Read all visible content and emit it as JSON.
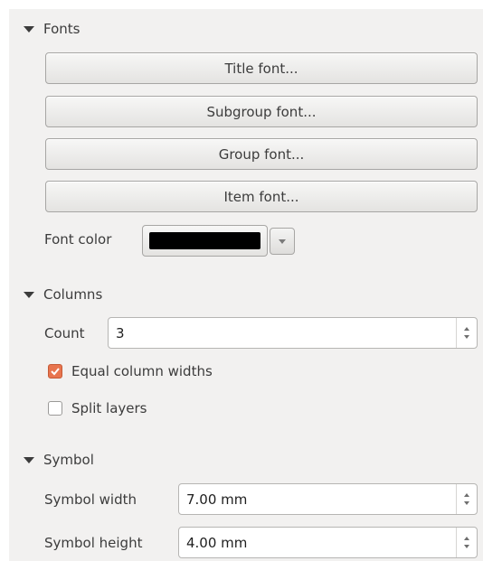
{
  "fonts": {
    "header": "Fonts",
    "buttons": [
      "Title font...",
      "Subgroup font...",
      "Group font...",
      "Item font..."
    ],
    "color_label": "Font color",
    "color_value": "#000000"
  },
  "columns": {
    "header": "Columns",
    "count_label": "Count",
    "count_value": "3",
    "equal_widths_label": "Equal column widths",
    "equal_widths_checked": true,
    "split_layers_label": "Split layers",
    "split_layers_checked": false
  },
  "symbol": {
    "header": "Symbol",
    "width_label": "Symbol width",
    "width_value": "7.00 mm",
    "height_label": "Symbol height",
    "height_value": "4.00 mm"
  },
  "colors": {
    "panel_bg": "#f2f1f0",
    "accent_checkbox": "#e8744e"
  }
}
